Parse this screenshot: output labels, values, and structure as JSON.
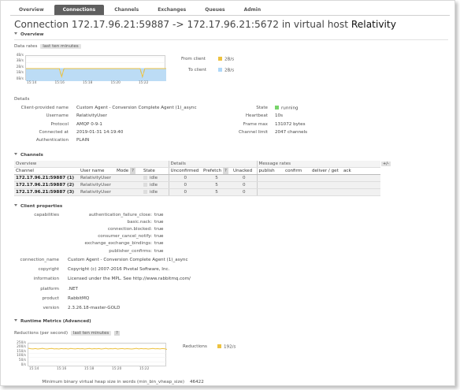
{
  "nav": {
    "tabs": [
      "Overview",
      "Connections",
      "Channels",
      "Exchanges",
      "Queues",
      "Admin"
    ],
    "active": "Connections"
  },
  "title": {
    "prefix": "Connection 172.17.96.21:59887 -> 172.17.96.21:5672 in virtual host",
    "vhost": "Relativity"
  },
  "overview": {
    "heading": "Overview",
    "data_rates_label": "Data rates",
    "range_pill": "last ten minutes",
    "legend": [
      {
        "label": "From client",
        "value": "2B/s",
        "color": "#edc240"
      },
      {
        "label": "To client",
        "value": "2B/s",
        "color": "#afd8f8"
      }
    ]
  },
  "details": {
    "heading": "Details",
    "left": [
      {
        "key": "Client-provided name",
        "value": "Custom Agent - Conversion Complete Agent (1)_async"
      },
      {
        "key": "Username",
        "value": "RelativityUser"
      },
      {
        "key": "Protocol",
        "value": "AMQP 0-9-1"
      },
      {
        "key": "Connected at",
        "value": "2019-01-31 14:19:40"
      },
      {
        "key": "Authentication",
        "value": "PLAIN"
      }
    ],
    "right": [
      {
        "key": "State",
        "value": "running"
      },
      {
        "key": "Heartbeat",
        "value": "10s"
      },
      {
        "key": "Frame max",
        "value": "131072 bytes"
      },
      {
        "key": "Channel limit",
        "value": "2047 channels"
      }
    ]
  },
  "channels": {
    "heading": "Channels",
    "groups": {
      "overview": "Overview",
      "details": "Details",
      "message_rates": "Message rates"
    },
    "plus_minus": "+/-",
    "columns": [
      "Channel",
      "User name",
      "Mode",
      "State",
      "Unconfirmed",
      "Prefetch",
      "Unacked",
      "publish",
      "confirm",
      "deliver / get",
      "ack"
    ],
    "help_mark": "?",
    "rows": [
      {
        "channel": "172.17.96.21:59887 (1)",
        "user": "RelativityUser",
        "mode": "",
        "state": "idle",
        "unconfirmed": "0",
        "prefetch": "5",
        "unacked": "0"
      },
      {
        "channel": "172.17.96.21:59887 (2)",
        "user": "RelativityUser",
        "mode": "",
        "state": "idle",
        "unconfirmed": "0",
        "prefetch": "5",
        "unacked": "0"
      },
      {
        "channel": "172.17.96.21:59887 (3)",
        "user": "RelativityUser",
        "mode": "",
        "state": "idle",
        "unconfirmed": "0",
        "prefetch": "5",
        "unacked": "0"
      }
    ]
  },
  "client_properties": {
    "heading": "Client properties",
    "capabilities_label": "capabilities",
    "capabilities": [
      {
        "key": "authentication_failure_close:",
        "value": "true"
      },
      {
        "key": "basic.nack:",
        "value": "true"
      },
      {
        "key": "connection.blocked:",
        "value": "true"
      },
      {
        "key": "consumer_cancel_notify:",
        "value": "true"
      },
      {
        "key": "exchange_exchange_bindings:",
        "value": "true"
      },
      {
        "key": "publisher_confirms:",
        "value": "true"
      }
    ],
    "props": [
      {
        "key": "connection_name",
        "value": "Custom Agent - Conversion Complete Agent (1)_async"
      },
      {
        "key": "copyright",
        "value": "Copyright (c) 2007-2016 Pivotal Software, Inc."
      },
      {
        "key": "information",
        "value": "Licensed under the MPL. See http://www.rabbitmq.com/"
      },
      {
        "key": "platform",
        "value": ".NET"
      },
      {
        "key": "product",
        "value": "RabbitMQ"
      },
      {
        "key": "version",
        "value": "2.3.26.18-master-GOLD"
      }
    ]
  },
  "runtime": {
    "heading": "Runtime Metrics (Advanced)",
    "reductions_label": "Reductions (per second)",
    "range_pill": "last ten minutes",
    "help_mark": "?",
    "legend": {
      "label": "Reductions",
      "value": "192/s",
      "color": "#edc240"
    },
    "heap_label": "Minimum binary virtual heap size in words (min_bin_vheap_size)",
    "heap_value": "46422"
  },
  "chart_data": [
    {
      "type": "line",
      "title": "",
      "y_ticks": [
        "4B/s",
        "3B/s",
        "2B/s",
        "1B/s",
        "0B/s"
      ],
      "x_ticks": [
        "15:14",
        "15:16",
        "15:18",
        "15:20",
        "15:22"
      ],
      "series": [
        {
          "name": "From client",
          "color": "#edc240",
          "values": [
            2,
            2,
            2,
            2,
            2,
            2,
            2,
            2,
            2,
            2,
            2,
            2,
            2,
            2,
            2,
            0.6,
            2,
            2,
            2,
            2,
            2,
            2,
            2,
            2,
            2,
            2,
            2,
            2,
            2,
            2,
            2,
            2,
            2,
            2,
            2,
            2,
            2,
            2,
            2,
            2,
            2,
            2,
            2,
            2,
            2,
            2,
            2,
            2,
            2,
            0.6,
            2,
            2,
            2,
            2,
            2,
            2,
            2,
            2,
            2,
            2
          ]
        },
        {
          "name": "To client",
          "color": "#afd8f8",
          "values": [
            2,
            2,
            2,
            2,
            2,
            2,
            2,
            2,
            2,
            2,
            2,
            2,
            2,
            2,
            2,
            2,
            2,
            2,
            2,
            2,
            2,
            2,
            2,
            2,
            2,
            2,
            2,
            2,
            2,
            2,
            2,
            2,
            2,
            2,
            2,
            2,
            2,
            2,
            2,
            2,
            2,
            2,
            2,
            2,
            2,
            2,
            2,
            2,
            2,
            2,
            2,
            2,
            2,
            2,
            2,
            2,
            2,
            2,
            2,
            2
          ]
        }
      ],
      "ylim": [
        0,
        4
      ]
    },
    {
      "type": "line",
      "title": "",
      "y_ticks": [
        "250/s",
        "200/s",
        "150/s",
        "100/s",
        "50/s",
        "0/s"
      ],
      "x_ticks": [
        "15:14",
        "15:16",
        "15:18",
        "15:20",
        "15:22"
      ],
      "series": [
        {
          "name": "Reductions",
          "color": "#edc240",
          "values": [
            205,
            200,
            198,
            202,
            196,
            200,
            204,
            199,
            197,
            201,
            203,
            198,
            200,
            196,
            202,
            199,
            201,
            197,
            203,
            200,
            198,
            202,
            199,
            201,
            196,
            200,
            203,
            198,
            201,
            199,
            202,
            197,
            200,
            204,
            198,
            201,
            199,
            203,
            197,
            200,
            202,
            198,
            201,
            199,
            196,
            200,
            204,
            198,
            202,
            199,
            201,
            197,
            200,
            203,
            199,
            201,
            198,
            202,
            200,
            192
          ]
        }
      ],
      "ylim": [
        0,
        250
      ]
    }
  ]
}
